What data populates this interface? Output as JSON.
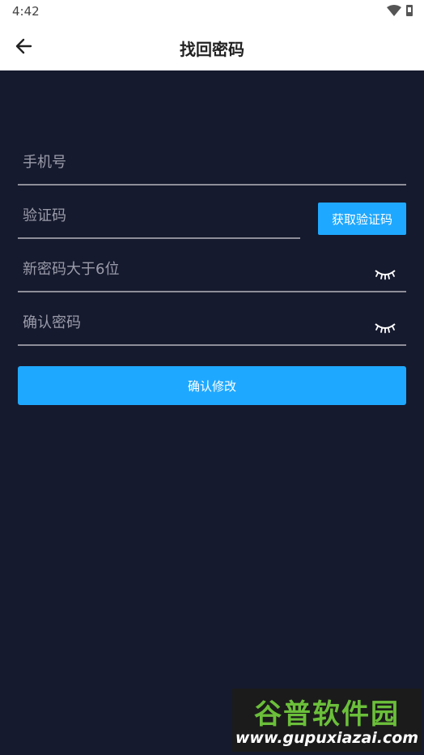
{
  "status_bar": {
    "time": "4:42"
  },
  "header": {
    "title": "找回密码"
  },
  "form": {
    "phone": {
      "placeholder": "手机号",
      "value": ""
    },
    "code": {
      "placeholder": "验证码",
      "value": "",
      "button_label": "获取验证码"
    },
    "new_password": {
      "placeholder": "新密码大于6位",
      "value": ""
    },
    "confirm_password": {
      "placeholder": "确认密码",
      "value": ""
    },
    "submit_label": "确认修改"
  },
  "watermark": {
    "title": "谷普软件园",
    "url": "www.gupuxiazai.com"
  },
  "colors": {
    "background": "#161a2e",
    "accent": "#1fa8ff",
    "line": "#8d8e99"
  },
  "icons": [
    "wifi-icon",
    "battery-icon",
    "back-arrow-icon",
    "eye-closed-icon"
  ]
}
